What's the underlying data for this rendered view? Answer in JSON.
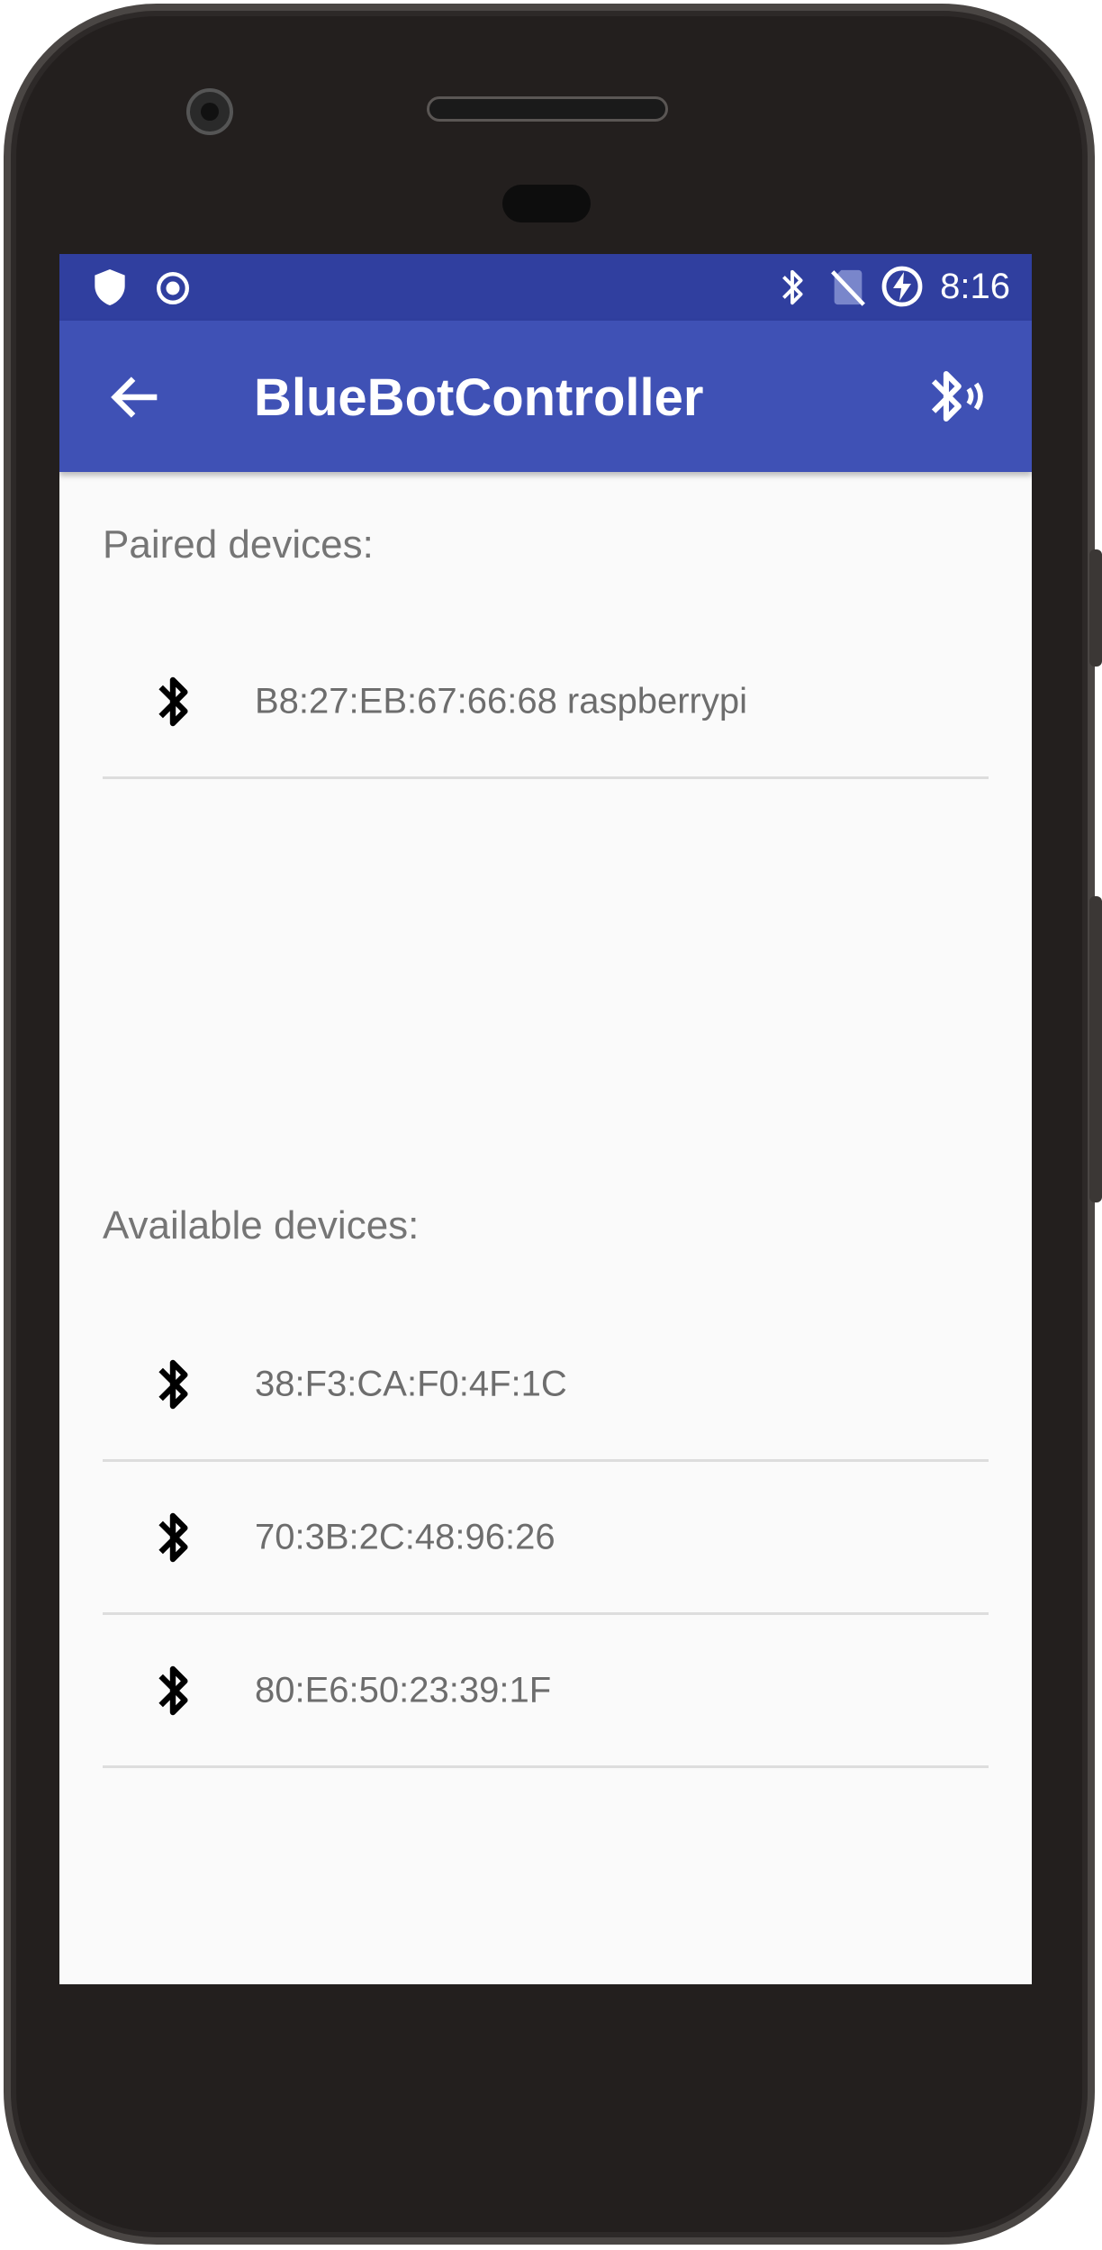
{
  "status_bar": {
    "time": "8:16",
    "left_icons": [
      "shield-icon",
      "target-icon"
    ],
    "right_icons": [
      "bluetooth-icon",
      "no-sim-icon",
      "battery-charging-icon"
    ]
  },
  "app_bar": {
    "title": "BlueBotController",
    "back_icon": "arrow-back-icon",
    "action_icon": "bluetooth-searching-icon",
    "color": "#3f51b5",
    "status_color": "#303f9f"
  },
  "paired": {
    "label": "Paired devices:",
    "devices": [
      {
        "name": "B8:27:EB:67:66:68 raspberrypi",
        "icon": "bluetooth-icon"
      }
    ]
  },
  "available": {
    "label": "Available devices:",
    "devices": [
      {
        "name": "38:F3:CA:F0:4F:1C",
        "icon": "bluetooth-icon"
      },
      {
        "name": "70:3B:2C:48:96:26",
        "icon": "bluetooth-icon"
      },
      {
        "name": "80:E6:50:23:39:1F",
        "icon": "bluetooth-icon"
      }
    ]
  }
}
